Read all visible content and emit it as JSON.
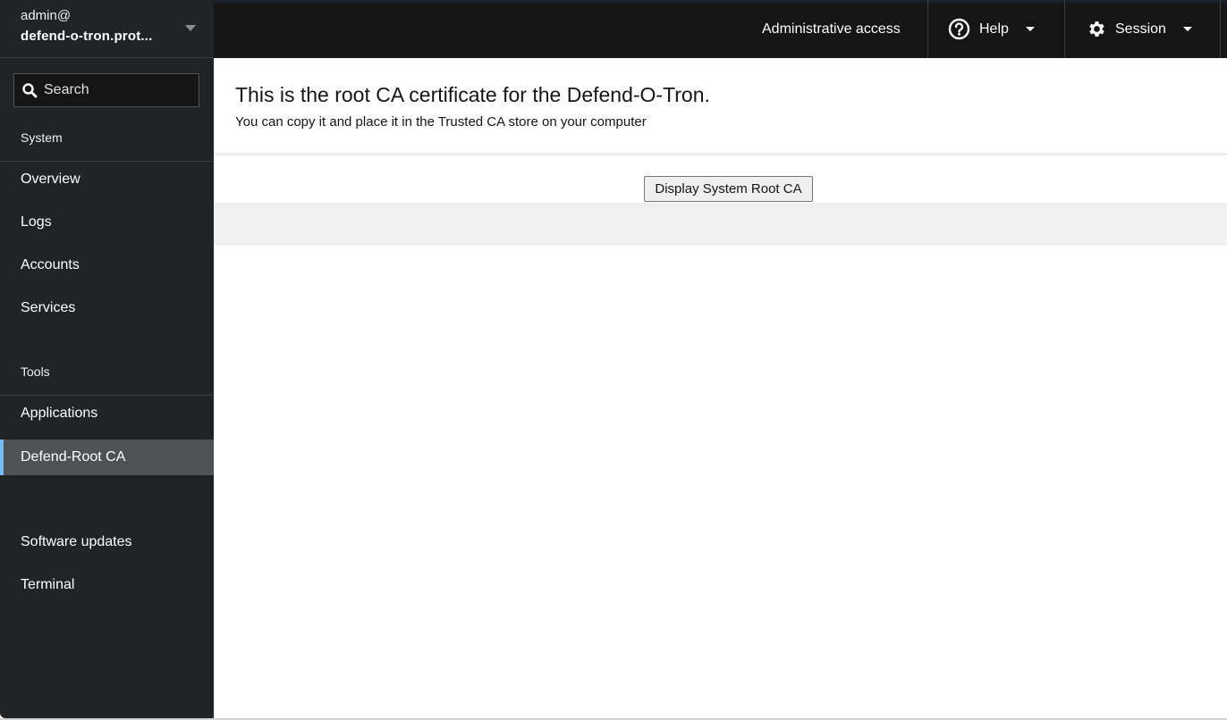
{
  "host": {
    "user": "admin@",
    "hostname": "defend-o-tron.prot..."
  },
  "search": {
    "placeholder": "Search"
  },
  "sidebar": {
    "sections": [
      {
        "title": "System",
        "items": [
          {
            "label": "Overview"
          },
          {
            "label": "Logs"
          },
          {
            "label": "Accounts"
          },
          {
            "label": "Services"
          }
        ]
      },
      {
        "title": "Tools",
        "items": [
          {
            "label": "Applications"
          },
          {
            "label": "Defend-Root CA",
            "active": true
          },
          {
            "label": "Software updates"
          },
          {
            "label": "Terminal"
          }
        ]
      }
    ]
  },
  "topbar": {
    "admin_access": "Administrative access",
    "help": {
      "label": "Help",
      "icon": "help-circle-icon"
    },
    "session": {
      "label": "Session",
      "icon": "gear-icon"
    }
  },
  "main": {
    "title": "This is the root CA certificate for the Defend-O-Tron.",
    "subtitle": "You can copy it and place it in the Trusted CA store on your computer",
    "display_button": "Display System Root CA"
  },
  "colors": {
    "sidebar_bg": "#212427",
    "topbar_bg": "#151515",
    "active_item_bg": "#4f5255",
    "active_accent": "#73bcf7"
  }
}
